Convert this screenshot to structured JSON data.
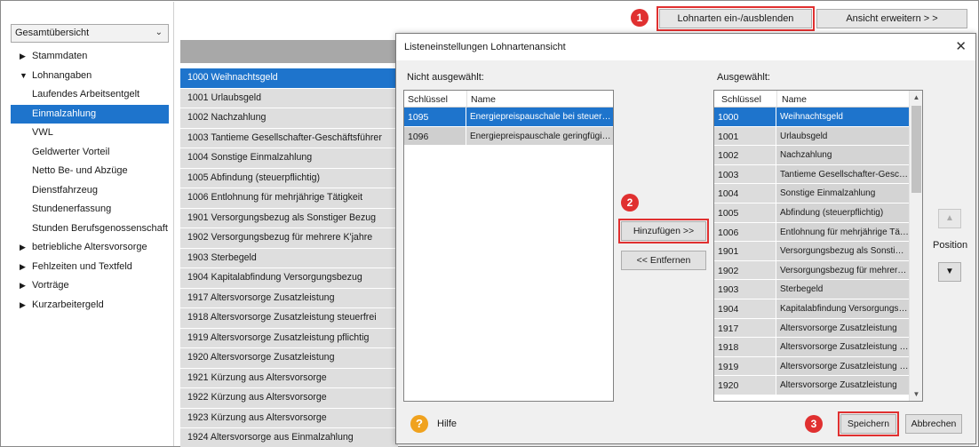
{
  "sidebar": {
    "dropdown_value": "Gesamtübersicht",
    "items": [
      {
        "label": "Stammdaten",
        "type": "collapsed"
      },
      {
        "label": "Lohnangaben",
        "type": "expanded"
      },
      {
        "label": "Laufendes Arbeitsentgelt",
        "type": "sub"
      },
      {
        "label": "Einmalzahlung",
        "type": "sub",
        "active": true
      },
      {
        "label": "VWL",
        "type": "sub"
      },
      {
        "label": "Geldwerter Vorteil",
        "type": "sub"
      },
      {
        "label": "Netto Be- und Abzüge",
        "type": "sub"
      },
      {
        "label": "Dienstfahrzeug",
        "type": "sub"
      },
      {
        "label": "Stundenerfassung",
        "type": "sub"
      },
      {
        "label": "Stunden Berufsgenossenschaft",
        "type": "sub"
      },
      {
        "label": "betriebliche Altersvorsorge",
        "type": "collapsed"
      },
      {
        "label": "Fehlzeiten und Textfeld",
        "type": "collapsed"
      },
      {
        "label": "Vorträge",
        "type": "collapsed"
      },
      {
        "label": "Kurzarbeitergeld",
        "type": "collapsed"
      }
    ]
  },
  "toolbar": {
    "toggle_label": "Lohnarten ein-/ausblenden",
    "expand_label": "Ansicht erweitern > >"
  },
  "badges": [
    "1",
    "2",
    "3"
  ],
  "main_list": [
    "1000 Weihnachtsgeld",
    "1001 Urlaubsgeld",
    "1002 Nachzahlung",
    "1003 Tantieme Gesellschafter-Geschäftsführer",
    "1004 Sonstige Einmalzahlung",
    "1005 Abfindung (steuerpflichtig)",
    "1006 Entlohnung für mehrjährige Tätigkeit",
    "1901 Versorgungsbezug als Sonstiger Bezug",
    "1902 Versorgungsbezug für mehrere K'jahre",
    "1903 Sterbegeld",
    "1904 Kapitalabfindung Versorgungsbezug",
    "1917 Altersvorsorge Zusatzleistung",
    "1918 Altersvorsorge Zusatzleistung steuerfrei",
    "1919 Altersvorsorge Zusatzleistung pflichtig",
    "1920 Altersvorsorge Zusatzleistung",
    "1921 Kürzung aus Altersvorsorge",
    "1922 Kürzung aus Altersvorsorge",
    "1923 Kürzung aus Altersvorsorge",
    "1924 Altersvorsorge aus Einmalzahlung"
  ],
  "dialog": {
    "title": "Listeneinstellungen Lohnartenansicht",
    "left_label": "Nicht ausgewählt:",
    "right_label": "Ausgewählt:",
    "col_key": "Schlüssel",
    "col_name": "Name",
    "left_rows": [
      {
        "key": "1095",
        "name": "Energiepreispauschale bei steuerpf..."
      },
      {
        "key": "1096",
        "name": "Energiepreispauschale geringfügig ..."
      }
    ],
    "right_rows": [
      {
        "key": "1000",
        "name": "Weihnachtsgeld"
      },
      {
        "key": "1001",
        "name": "Urlaubsgeld"
      },
      {
        "key": "1002",
        "name": "Nachzahlung"
      },
      {
        "key": "1003",
        "name": "Tantieme Gesellschafter-Gesch..."
      },
      {
        "key": "1004",
        "name": "Sonstige Einmalzahlung"
      },
      {
        "key": "1005",
        "name": "Abfindung (steuerpflichtig)"
      },
      {
        "key": "1006",
        "name": "Entlohnung für mehrjährige Täti..."
      },
      {
        "key": "1901",
        "name": "Versorgungsbezug als Sonstige..."
      },
      {
        "key": "1902",
        "name": "Versorgungsbezug für mehrere ..."
      },
      {
        "key": "1903",
        "name": "Sterbegeld"
      },
      {
        "key": "1904",
        "name": "Kapitalabfindung Versorgungsb..."
      },
      {
        "key": "1917",
        "name": "Altersvorsorge Zusatzleistung"
      },
      {
        "key": "1918",
        "name": "Altersvorsorge Zusatzleistung st..."
      },
      {
        "key": "1919",
        "name": "Altersvorsorge Zusatzleistung p..."
      },
      {
        "key": "1920",
        "name": "Altersvorsorge Zusatzleistung"
      }
    ],
    "add_label": "Hinzufügen >>",
    "remove_label": "<< Entfernen",
    "position_label": "Position",
    "help_label": "Hilfe",
    "save_label": "Speichern",
    "cancel_label": "Abbrechen"
  },
  "colors": {
    "selection": "#1e74cc",
    "highlight": "#e03030",
    "help": "#f0a21e"
  }
}
